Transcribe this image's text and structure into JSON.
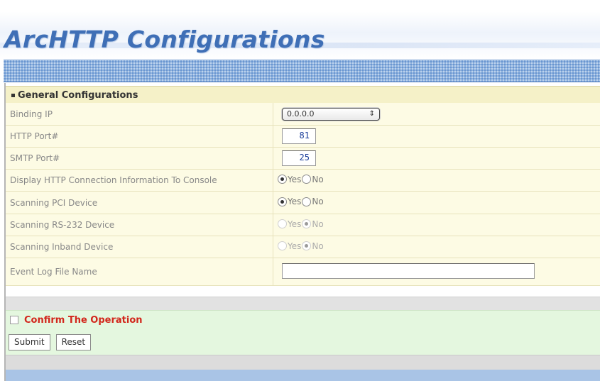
{
  "page": {
    "title": "ArcHTTP Configurations"
  },
  "section": {
    "title": "General Configurations"
  },
  "rows": [
    {
      "label": "Binding IP",
      "type": "select",
      "value": "0.0.0.0"
    },
    {
      "label": "HTTP Port#",
      "type": "number",
      "value": "81"
    },
    {
      "label": "SMTP Port#",
      "type": "number",
      "value": "25"
    },
    {
      "label": "Display HTTP Connection Information To Console",
      "type": "radio",
      "yes_label": "Yes",
      "no_label": "No",
      "selected": "yes",
      "disabled": false
    },
    {
      "label": "Scanning PCI Device",
      "type": "radio",
      "yes_label": "Yes",
      "no_label": "No",
      "selected": "yes",
      "disabled": false
    },
    {
      "label": "Scanning RS-232 Device",
      "type": "radio",
      "yes_label": "Yes",
      "no_label": "No",
      "selected": "no",
      "disabled": true
    },
    {
      "label": "Scanning Inband Device",
      "type": "radio",
      "yes_label": "Yes",
      "no_label": "No",
      "selected": "no",
      "disabled": true
    },
    {
      "label": "Event Log File Name",
      "type": "text",
      "value": ""
    }
  ],
  "confirm": {
    "label": "Confirm The Operation",
    "checked": false
  },
  "buttons": {
    "submit": "Submit",
    "reset": "Reset"
  },
  "colors": {
    "title": "#3f6fb6",
    "section_bg": "#f5f1c8",
    "row_bg": "#fdfbe4",
    "confirm_bg": "#e4f7df",
    "confirm_text": "#d2271c"
  },
  "icons": {
    "select_arrow": "updown-arrows-icon",
    "section_bullet": "square-bullet-icon"
  }
}
